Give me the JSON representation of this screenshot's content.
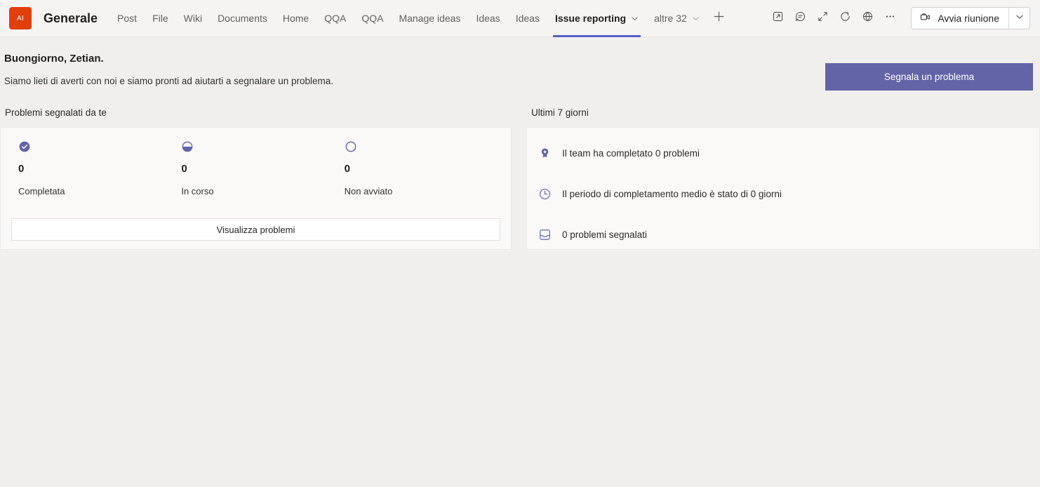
{
  "header": {
    "logo_text": "AI",
    "channel_title": "Generale",
    "tabs": [
      {
        "label": "Post",
        "active": false,
        "has_chevron": false
      },
      {
        "label": "File",
        "active": false,
        "has_chevron": false
      },
      {
        "label": "Wiki",
        "active": false,
        "has_chevron": false
      },
      {
        "label": "Documents",
        "active": false,
        "has_chevron": false
      },
      {
        "label": "Home",
        "active": false,
        "has_chevron": false
      },
      {
        "label": "QQA",
        "active": false,
        "has_chevron": false
      },
      {
        "label": "QQA",
        "active": false,
        "has_chevron": false
      },
      {
        "label": "Manage ideas",
        "active": false,
        "has_chevron": false
      },
      {
        "label": "Ideas",
        "active": false,
        "has_chevron": false
      },
      {
        "label": "Ideas",
        "active": false,
        "has_chevron": false
      },
      {
        "label": "Issue reporting",
        "active": true,
        "has_chevron": true
      },
      {
        "label": "altre 32",
        "active": false,
        "has_chevron": true
      }
    ],
    "add_tab_icon": "plus-icon",
    "right_icons": [
      "open-in-new-window-icon",
      "chat-icon",
      "expand-icon",
      "refresh-icon",
      "globe-icon",
      "more-options-icon"
    ],
    "meeting_button": {
      "label": "Avvia riunione",
      "icon": "video-camera-icon",
      "dropdown_icon": "chevron-down-icon"
    }
  },
  "greeting": {
    "title": "Buongiorno, Zetian.",
    "subtitle": "Siamo lieti di averti con noi e siamo pronti ad aiutarti a segnalare un problema.",
    "report_button_label": "Segnala un problema"
  },
  "left_panel": {
    "heading": "Problemi segnalati da te",
    "stats": [
      {
        "icon": "check-circle-filled-icon",
        "value": "0",
        "label": "Completata"
      },
      {
        "icon": "half-circle-icon",
        "value": "0",
        "label": "In corso"
      },
      {
        "icon": "empty-circle-icon",
        "value": "0",
        "label": "Non avviato"
      }
    ],
    "view_button_label": "Visualizza problemi"
  },
  "right_panel": {
    "heading": "Ultimi 7 giorni",
    "items": [
      {
        "icon": "award-ribbon-icon",
        "text": "Il team ha completato 0 problemi"
      },
      {
        "icon": "clock-icon",
        "text": "Il periodo di completamento medio è stato di 0 giorni"
      },
      {
        "icon": "inbox-icon",
        "text": "0 problemi segnalati"
      }
    ]
  },
  "colors": {
    "accent_purple": "#6264A7",
    "tab_underline": "#5B5FC7",
    "logo_orange": "#E03E0C",
    "page_background": "#F0EFEE",
    "card_background": "#FAF9F8"
  }
}
